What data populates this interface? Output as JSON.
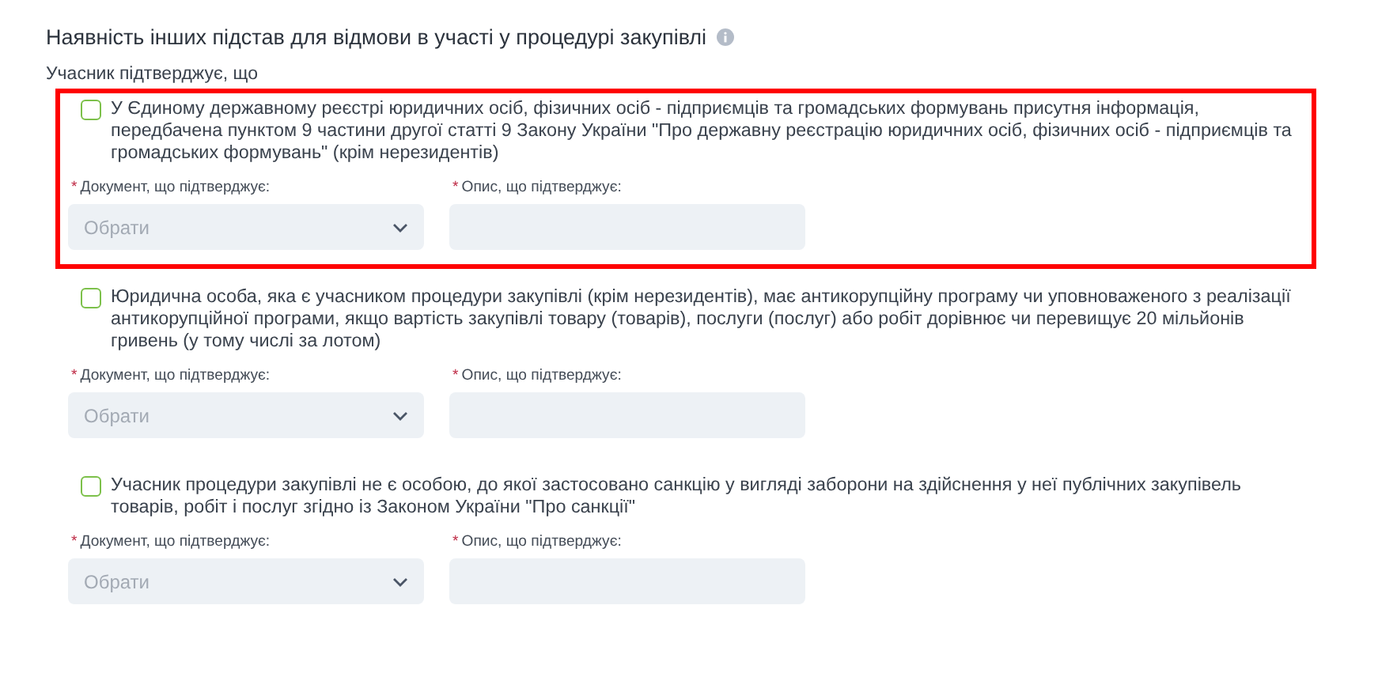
{
  "section": {
    "title": "Наявність інших підстав для відмови в участі у процедурі закупівлі",
    "subtitle": "Учасник підтверджує, що"
  },
  "items": [
    {
      "text": "У Єдиному державному реєстрі юридичних осіб, фізичних осіб - підприємців та громадських формувань присутня інформація, передбачена пунктом 9 частини другої статті 9 Закону України \"Про державну реєстрацію юридичних осіб, фізичних осіб - підприємців та громадських формувань\" (крім нерезидентів)",
      "checked": false,
      "highlighted": true,
      "document": {
        "mark": "*",
        "label": "Документ, що підтверджує:",
        "placeholder": "Обрати"
      },
      "description": {
        "mark": "*",
        "label": "Опис, що підтверджує:"
      }
    },
    {
      "text": "Юридична особа, яка є учасником процедури закупівлі (крім нерезидентів), має антикорупційну програму чи уповноваженого з реалізації антикорупційної програми, якщо вартість закупівлі товару (товарів), послуги (послуг) або робіт дорівнює чи перевищує 20 мільйонів гривень (у тому числі за лотом)",
      "checked": false,
      "highlighted": false,
      "document": {
        "mark": "*",
        "label": "Документ, що підтверджує:",
        "placeholder": "Обрати"
      },
      "description": {
        "mark": "*",
        "label": "Опис, що підтверджує:"
      }
    },
    {
      "text": "Учасник процедури закупівлі не є особою, до якої застосовано санкцію у вигляді заборони на здійснення у неї публічних закупівель товарів, робіт і послуг згідно із Законом України \"Про санкції\"",
      "checked": false,
      "highlighted": false,
      "document": {
        "mark": "*",
        "label": "Документ, що підтверджує:",
        "placeholder": "Обрати"
      },
      "description": {
        "mark": "*",
        "label": "Опис, що підтверджує:"
      }
    }
  ]
}
